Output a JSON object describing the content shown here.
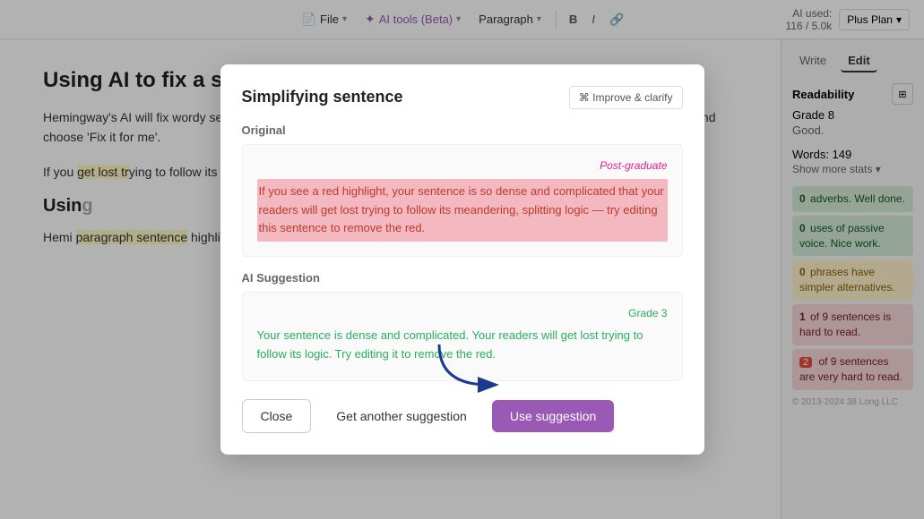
{
  "toolbar": {
    "file_label": "File",
    "ai_tools_label": "AI tools (Beta)",
    "paragraph_label": "Paragraph",
    "bold_label": "B",
    "italic_label": "I",
    "link_label": "🔗",
    "ai_used_label": "AI used:",
    "ai_used_count": "116 / 5.0k",
    "plan_label": "Plus Plan"
  },
  "sidebar": {
    "write_tab": "Write",
    "edit_tab": "Edit",
    "readability_label": "Readability",
    "readability_icon": "⊞",
    "grade_label": "Grade 8",
    "good_label": "Good.",
    "words_label": "Words: 149",
    "show_more": "Show more stats ▾",
    "stats": [
      {
        "num": "0",
        "text": "adverbs. Well done.",
        "type": "green"
      },
      {
        "num": "0",
        "text": "uses of passive voice. Nice work.",
        "type": "green"
      },
      {
        "num": "0",
        "text": "phrases have simpler alternatives.",
        "type": "yellow"
      },
      {
        "num": "1",
        "text": "of 9 sentences is hard to read.",
        "type": "red"
      },
      {
        "num": "2",
        "text": "of 9 sentences are very hard to read.",
        "type": "pink",
        "badge": true
      }
    ],
    "copyright": "© 2013-2024 38 Long LLC"
  },
  "editor": {
    "title": "Using AI to fix a sentence",
    "para1": "Hemingway's AI will fix wordy sentences, making them easier to read. Click on the sentence below highlighted in red, and choose 'Fix it for me'.",
    "para2_prefix": "If you",
    "para2_highlight": "get lost tr",
    "para2_suffix": "ying to follow its meandering, splitting logic — try editing this sentence to remove the red.",
    "section2_title": "Usin",
    "para3": "Hemi paragraph sentence highligh follow"
  },
  "modal": {
    "title": "Simplifying sentence",
    "improve_btn": "⌘ Improve & clarify",
    "original_label": "Original",
    "original_grade": "Post-graduate",
    "original_text": "If you see a red highlight, your sentence is so dense and complicated that your readers will get lost trying to follow its meandering, splitting logic — try editing this sentence to remove the red.",
    "suggestion_label": "AI Suggestion",
    "suggestion_grade": "Grade 3",
    "suggestion_text": "Your sentence is dense and complicated. Your readers will get lost trying to follow its logic. Try editing it to remove the red.",
    "close_btn": "Close",
    "get_suggestion_btn": "Get another suggestion",
    "use_suggestion_btn": "Use suggestion"
  }
}
